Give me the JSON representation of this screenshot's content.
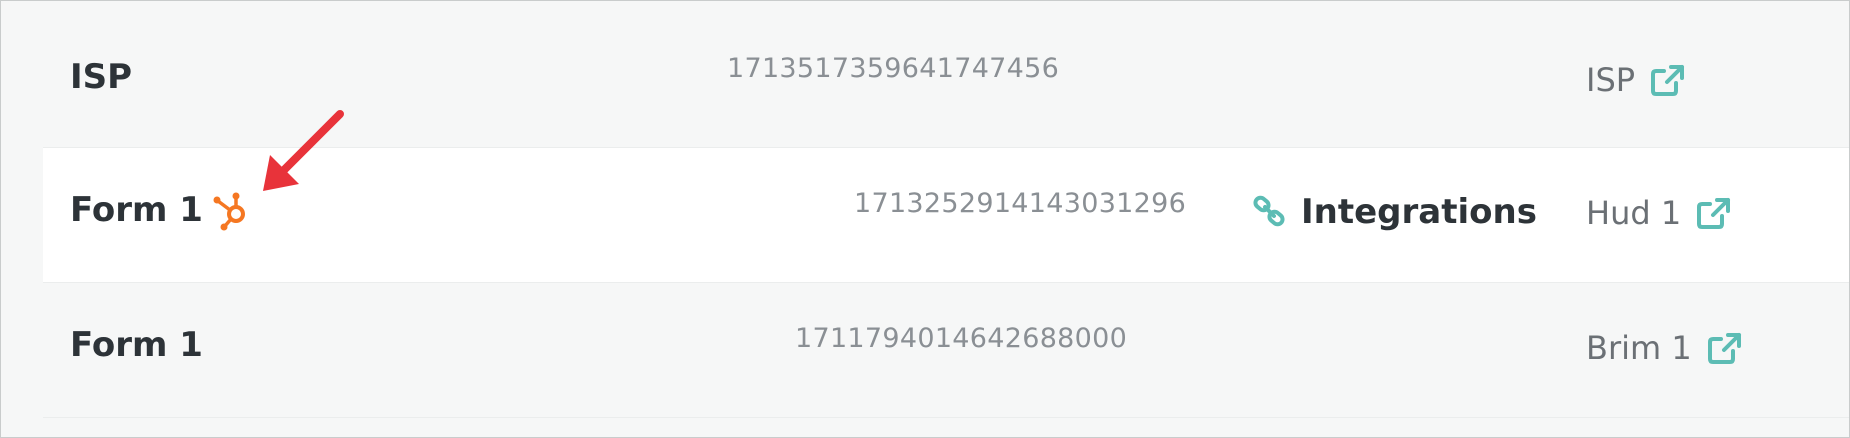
{
  "colors": {
    "accent_teal": "#5cbcb4",
    "hubspot_orange": "#f57722",
    "arrow_red": "#e8333a",
    "text_dark": "#2d3338",
    "text_muted": "#8a8f94"
  },
  "rows": [
    {
      "name": "ISP",
      "id": "1713517359641747456",
      "integration": "",
      "link_label": "ISP",
      "link_icon": "external-link-icon"
    },
    {
      "name": "Form 1",
      "name_icon": "hubspot-icon",
      "id": "1713252914143031296",
      "integration_icon": "link-icon",
      "integration": "Integrations",
      "link_label": "Hud 1",
      "link_icon": "external-link-icon"
    },
    {
      "name": "Form 1",
      "id": "1711794014642688000",
      "integration": "",
      "link_label": "Brim 1",
      "link_icon": "external-link-icon"
    }
  ],
  "annotation": {
    "arrow_icon": "red-arrow-icon"
  }
}
